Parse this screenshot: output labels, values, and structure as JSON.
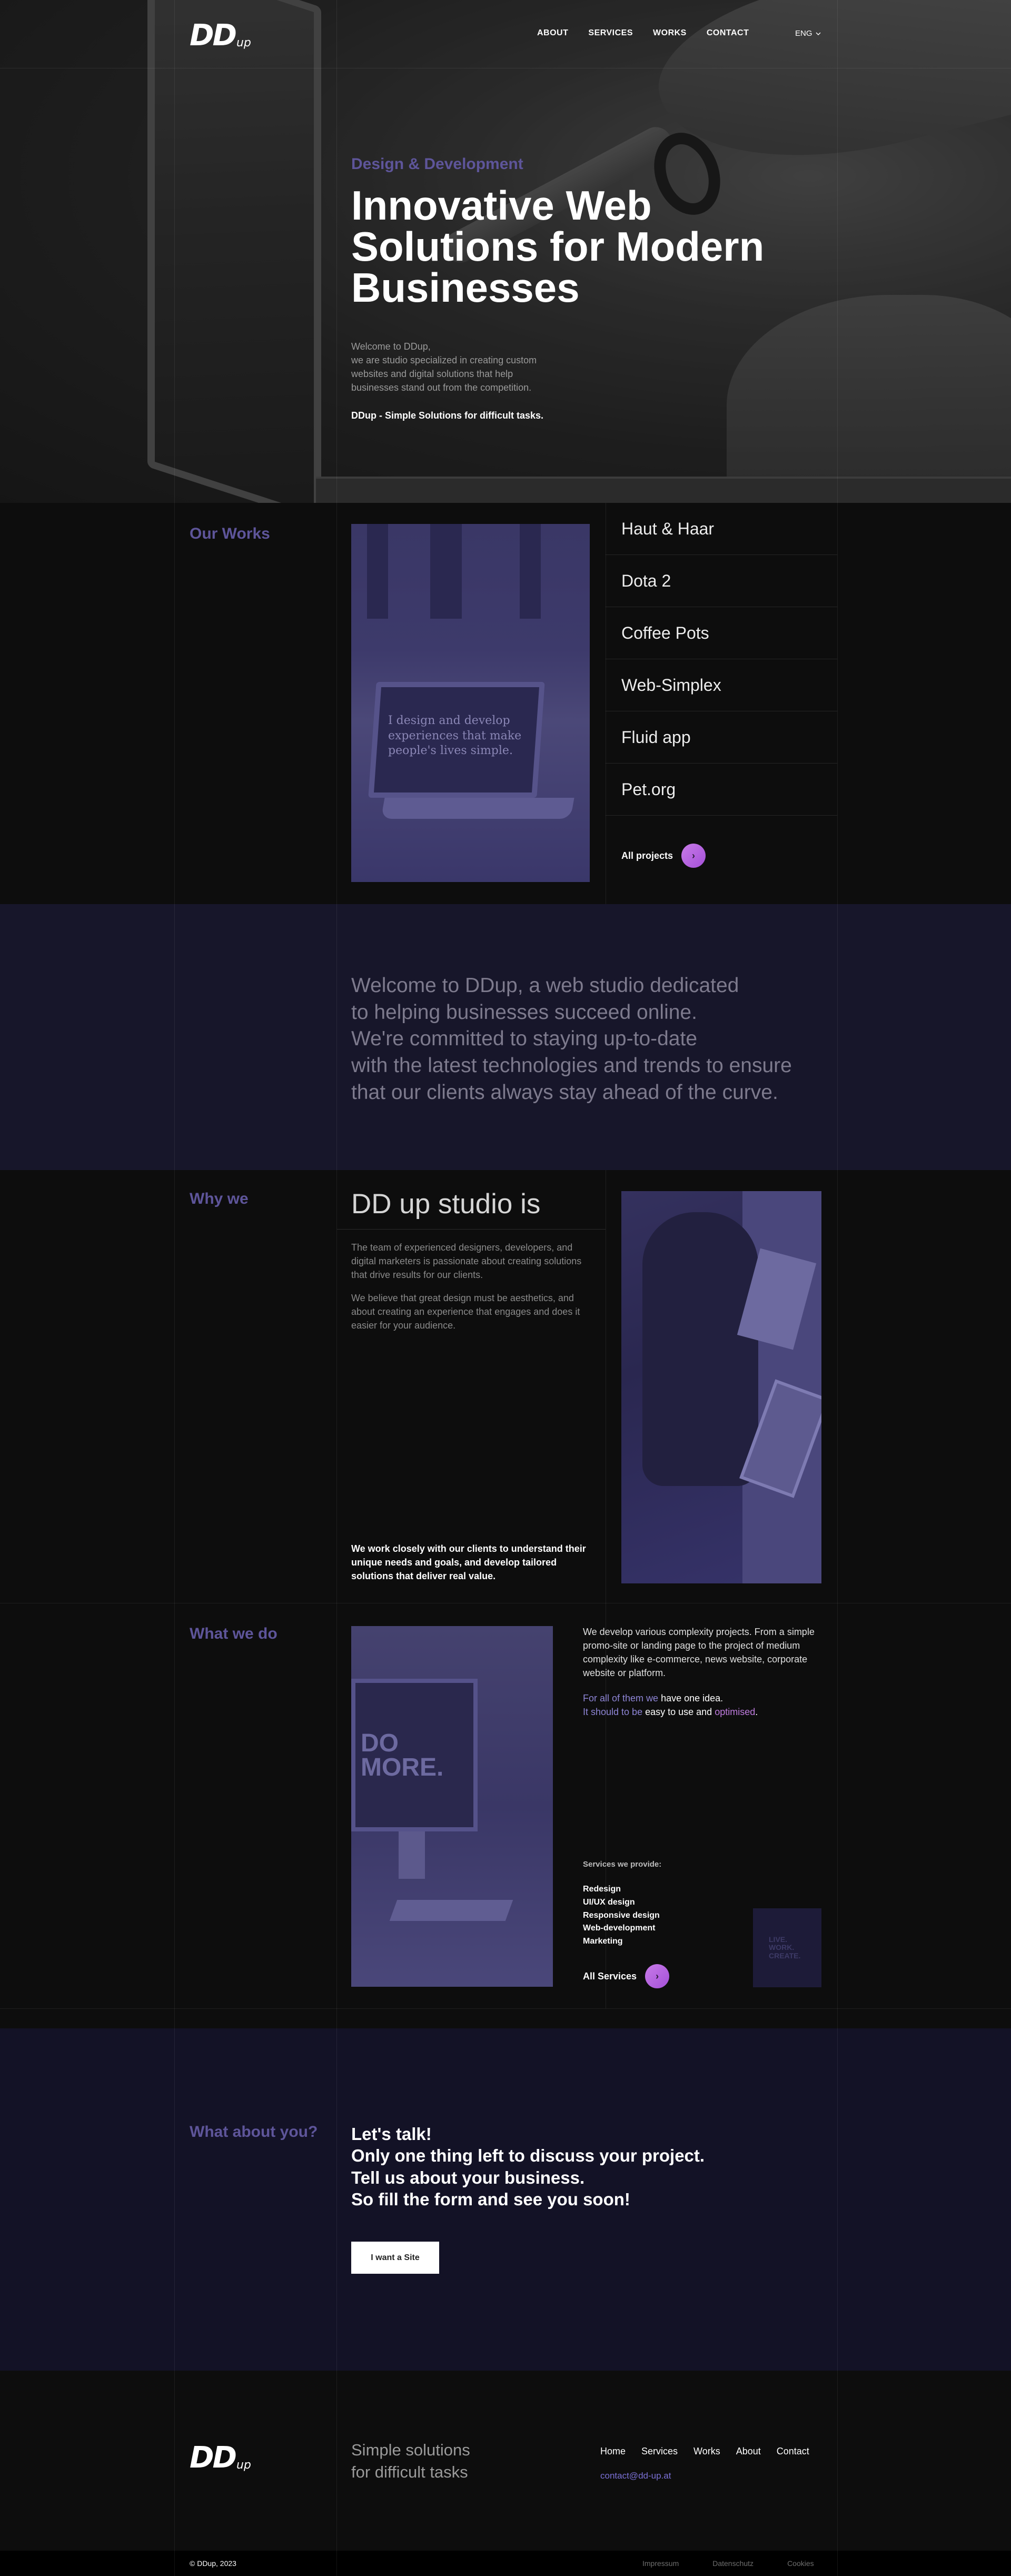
{
  "nav": {
    "logo_big": "DD",
    "logo_small": "up",
    "links": [
      "ABOUT",
      "SERVICES",
      "WORKS",
      "CONTACT"
    ],
    "lang": "ENG",
    "lang_icon": "chevron-down-icon"
  },
  "hero": {
    "kicker": "Design & Development",
    "title_lines": [
      "Innovative Web",
      "Solutions for Modern",
      "Businesses"
    ],
    "desc_lines": [
      "Welcome to DDup,",
      "we are studio specialized in creating custom",
      "websites and digital solutions that help",
      "businesses stand out from the competition."
    ],
    "tagline": "DDup - Simple Solutions for difficult tasks."
  },
  "works": {
    "label": "Our Works",
    "image_text": "I design and develop experiences that make people's lives simple.",
    "items": [
      "Haut & Haar",
      "Dota 2",
      "Coffee Pots",
      "Web-Simplex",
      "Fluid app",
      "Pet.org"
    ],
    "all_label": "All projects",
    "arrow": "›"
  },
  "welcome": {
    "lines": [
      "Welcome to DDup, a web studio dedicated",
      "to helping businesses succeed online.",
      "We're committed to staying up-to-date",
      "with the latest technologies and trends to ensure",
      "that our clients always stay ahead of the curve."
    ]
  },
  "why": {
    "label": "Why we",
    "title": "DD up studio is",
    "p1": "The team of experienced designers, developers, and digital marketers is passionate about creating solutions that drive results for our clients.",
    "p2": "We believe that great design must be aesthetics, and about creating an experience that engages and does it easier for your audience.",
    "bold": "We work closely with our clients to understand their unique needs and goals, and develop tailored solutions that deliver real value."
  },
  "what": {
    "label": "What we do",
    "image_text": "DO MORE.",
    "p1": "We develop various complexity projects. From a simple promo-site or landing page to the project of medium complexity like e-commerce, news website, corporate website or platform.",
    "p2_a": "For all of them we",
    "p2_b": " have one idea.",
    "p2_c": "It should to be",
    "p2_d": " easy to use and ",
    "p2_e": "optimised",
    "p2_f": ".",
    "services_title": "Services we provide:",
    "services": [
      "Redesign",
      "UI/UX design",
      "Responsive design",
      "Web-development",
      "Marketing"
    ],
    "all_label": "All Services",
    "arrow": "›",
    "small_image_text": "LIVE. WORK. CREATE."
  },
  "about": {
    "label": "What about you?",
    "lines": [
      "Let's talk!",
      "Only one thing left to discuss your project.",
      "Tell us about your business.",
      "So fill the form and see you soon!"
    ],
    "button": "I want a Site"
  },
  "footer": {
    "logo_big": "DD",
    "logo_small": "up",
    "slogan_lines": [
      "Simple solutions",
      "for difficult tasks"
    ],
    "links": [
      "Home",
      "Services",
      "Works",
      "About",
      "Contact"
    ],
    "email": "contact@dd-up.at",
    "copyright": "© DDup, 2023",
    "legal": [
      "Impressum",
      "Datenschutz",
      "Cookies"
    ]
  }
}
